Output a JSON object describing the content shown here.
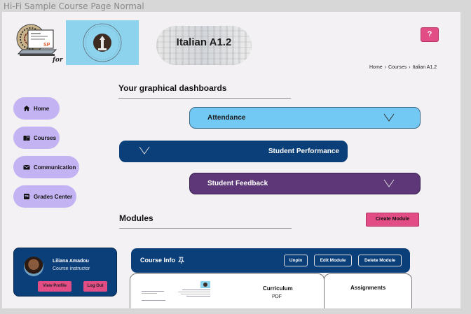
{
  "frame": {
    "title": "Hi-Fi Sample Course Page Normal"
  },
  "header": {
    "logo_text": "SP",
    "for_text": "for",
    "course_title": "Italian A1.2",
    "help_label": "?",
    "breadcrumb": [
      "Home",
      "Courses",
      "Italian A1.2"
    ],
    "breadcrumb_sep": "›"
  },
  "nav": {
    "items": [
      {
        "label": "Home",
        "icon": "home-icon"
      },
      {
        "label": "Courses",
        "icon": "book-icon"
      },
      {
        "label": "Communication",
        "icon": "mail-icon"
      },
      {
        "label": "Grades Center",
        "icon": "grades-icon"
      }
    ]
  },
  "dashboards": {
    "title": "Your graphical dashboards",
    "attendance": "Attendance",
    "performance": "Student Performance",
    "feedback": "Student Feedback"
  },
  "modules": {
    "title": "Modules",
    "create_label": "Create Module"
  },
  "profile": {
    "name": "Liliana Amadou",
    "role": "Course instructor",
    "view_label": "View Profile",
    "logout_label": "Log Out"
  },
  "course_info": {
    "title": "Course Info",
    "unpin_label": "Unpin",
    "edit_label": "Edit Module",
    "delete_label": "Delete Module"
  },
  "panels": {
    "curriculum_title": "Curriculum",
    "curriculum_sub": "PDF",
    "assignments_title": "Assignments"
  },
  "colors": {
    "accent_pink": "#e24d85",
    "nav_purple": "#c4b3f3",
    "navy": "#0b3f79",
    "attendance_blue": "#72c9f4",
    "feedback_purple": "#5d3777"
  }
}
